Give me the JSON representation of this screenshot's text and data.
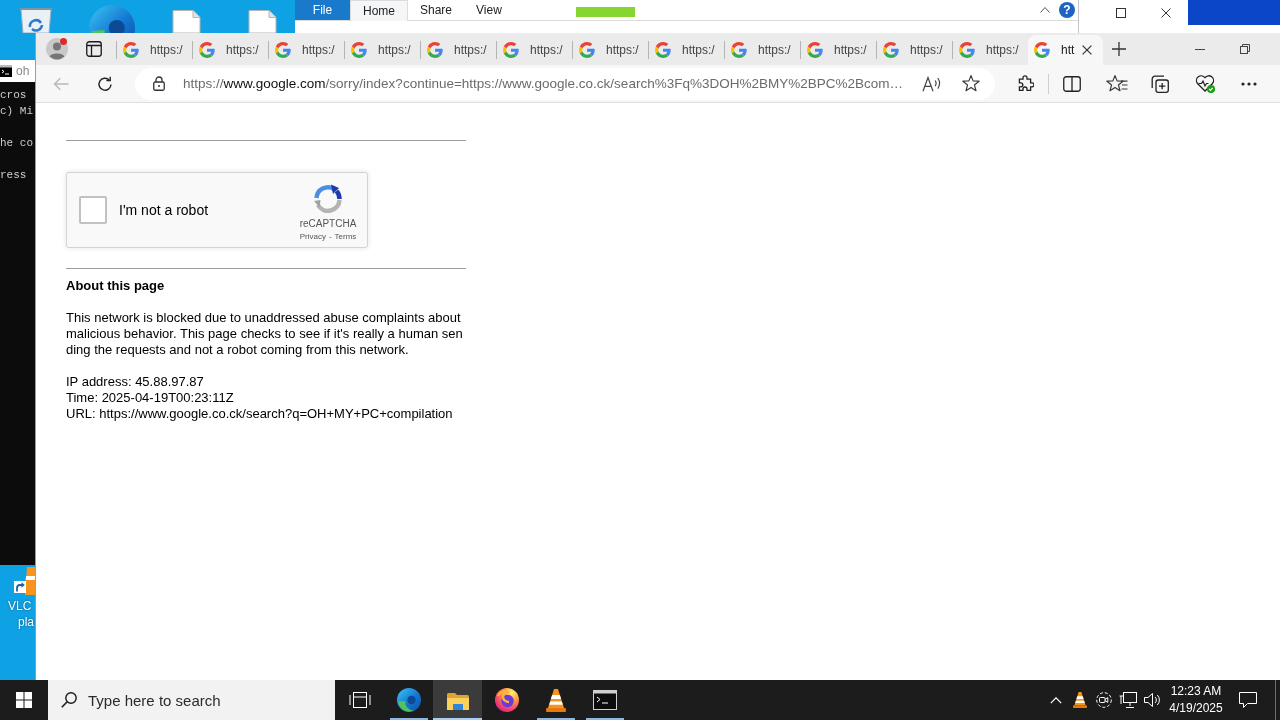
{
  "desktop": {
    "shortcut": {
      "label_lines": [
        "VLC",
        "pla"
      ]
    }
  },
  "explorer_window": {
    "ribbon_tabs": [
      {
        "label": "File",
        "kind": "file",
        "selected": false
      },
      {
        "label": "Home",
        "kind": "tab",
        "selected": true
      },
      {
        "label": "Share",
        "kind": "tab",
        "selected": false
      },
      {
        "label": "View",
        "kind": "tab",
        "selected": false
      }
    ],
    "help": "?"
  },
  "terminal_window": {
    "title": "oh",
    "lines": [
      "cros",
      "c) Mi",
      "he co",
      "ress"
    ]
  },
  "browser": {
    "tabs": [
      {
        "title": "https:/",
        "selected": false
      },
      {
        "title": "https:/",
        "selected": false
      },
      {
        "title": "https:/",
        "selected": false
      },
      {
        "title": "https:/",
        "selected": false
      },
      {
        "title": "https:/",
        "selected": false
      },
      {
        "title": "https:/",
        "selected": false
      },
      {
        "title": "https:/",
        "selected": false
      },
      {
        "title": "https:/",
        "selected": false
      },
      {
        "title": "https:/",
        "selected": false
      },
      {
        "title": "https:/",
        "selected": false
      },
      {
        "title": "https:/",
        "selected": false
      },
      {
        "title": "https:/",
        "selected": false
      },
      {
        "title": "htt",
        "selected": true
      }
    ],
    "back_button": {
      "disabled": true
    },
    "address": {
      "scheme": "https://",
      "host": "www.google.com",
      "path": "/sorry/index?continue=https://www.google.co.ck/search%3Fq%3DOH%2BMY%2BPC%2Bcom…"
    }
  },
  "page": {
    "captcha": {
      "checked": false,
      "label": "I'm not a robot",
      "brand": "reCAPTCHA",
      "links": [
        "Privacy",
        "Terms"
      ],
      "link_separator": "-"
    },
    "heading": "About this page",
    "paragraph": "This network is blocked due to unaddressed abuse complaints about malicious behavior. This page checks to see if it's really a human sending the requests and not a robot coming from this network.",
    "details": [
      "IP address: 45.88.97.87",
      "Time: 2025-04-19T00:23:11Z",
      "URL: https://www.google.co.ck/search?q=OH+MY+PC+compilation"
    ]
  },
  "taskbar": {
    "search": {
      "placeholder": "Type here to search"
    },
    "apps": [
      {
        "kind": "edge",
        "running": true,
        "selected": false
      },
      {
        "kind": "file-explorer",
        "running": true,
        "selected": true
      },
      {
        "kind": "firefox",
        "running": false,
        "selected": false
      },
      {
        "kind": "vlc",
        "running": true,
        "selected": false
      },
      {
        "kind": "terminal",
        "running": true,
        "selected": false
      }
    ],
    "clock": {
      "time": "12:23 AM",
      "date": "4/19/2025"
    }
  }
}
